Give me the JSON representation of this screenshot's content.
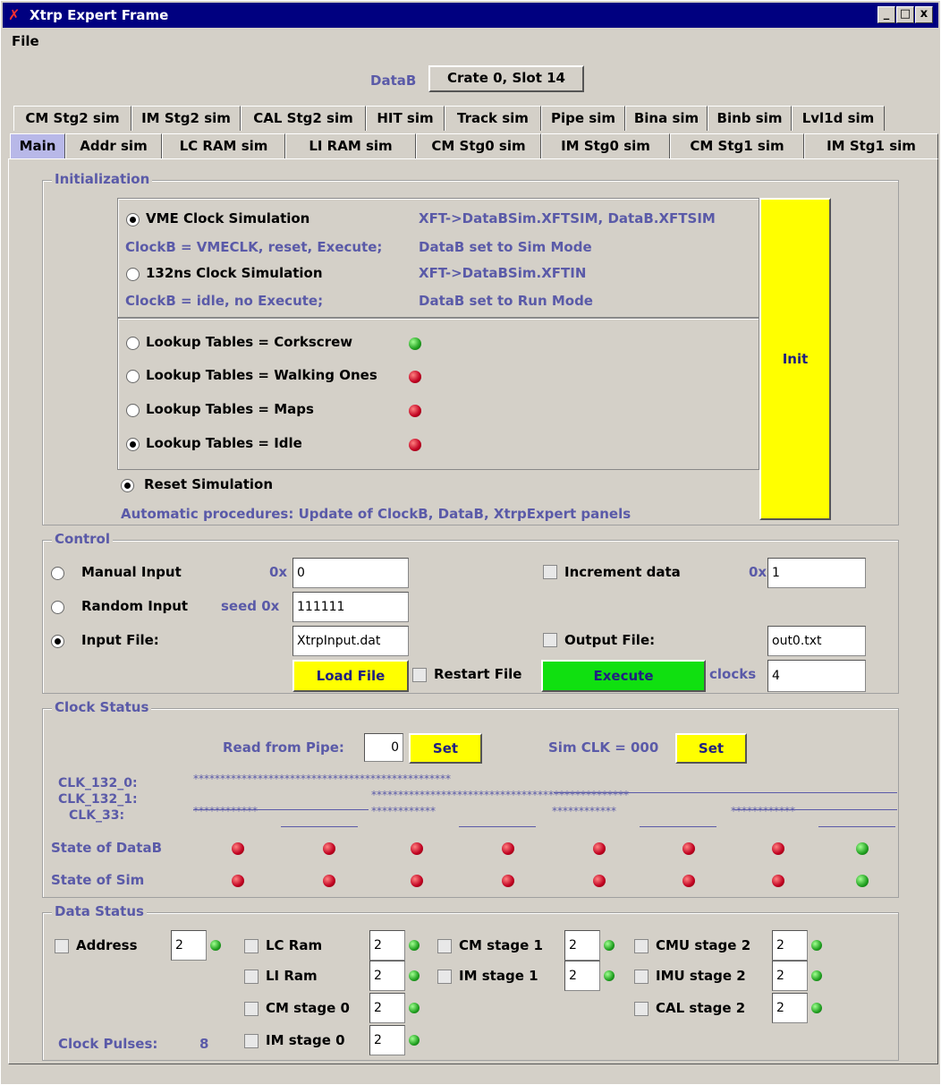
{
  "window": {
    "title": "Xtrp Expert Frame",
    "min": "_",
    "max": "□",
    "close": "x"
  },
  "menu": {
    "file": "File"
  },
  "header": {
    "datab_label": "DataB",
    "crate_button": "Crate 0, Slot 14"
  },
  "tabs_row1": [
    "CM Stg2 sim",
    "IM Stg2 sim",
    "CAL Stg2 sim",
    "HIT sim",
    "Track sim",
    "Pipe sim",
    "Bina sim",
    "Binb sim",
    "Lvl1d sim"
  ],
  "tabs_row2": [
    "Main",
    "Addr sim",
    "LC RAM sim",
    "LI RAM sim",
    "CM Stg0 sim",
    "IM Stg0 sim",
    "CM Stg1 sim",
    "IM Stg1 sim"
  ],
  "initialization": {
    "legend": "Initialization",
    "vme_clock": "VME Clock Simulation",
    "vme_desc": "XFT->DataBSim.XFTSIM, DataB.XFTSIM",
    "vme_clockb": "ClockB = VMECLK, reset, Execute;",
    "vme_datab": "DataB set to Sim Mode",
    "clk132": "132ns Clock Simulation",
    "clk132_desc": "XFT->DataBSim.XFTIN",
    "clk132_clockb": "ClockB = idle, no Execute;",
    "clk132_datab": "DataB set to Run Mode",
    "lookup": [
      "Lookup Tables = Corkscrew",
      "Lookup Tables = Walking Ones",
      "Lookup Tables = Maps",
      "Lookup Tables = Idle"
    ],
    "lookup_status": [
      "green",
      "red",
      "red",
      "red"
    ],
    "reset": "Reset Simulation",
    "auto_proc": "Automatic procedures:  Update of ClockB, DataB, XtrpExpert panels",
    "init_button": "Init"
  },
  "control": {
    "legend": "Control",
    "manual": "Manual Input",
    "manual_prefix": "0x",
    "manual_value": "0",
    "random": "Random Input",
    "seed_prefix": "seed  0x",
    "seed_value": "111111",
    "input_file": "Input File:",
    "input_file_value": "XtrpInput.dat",
    "load_file": "Load File",
    "restart_file": "Restart File",
    "increment": "Increment data",
    "increment_prefix": "0x",
    "increment_value": "1",
    "output_file": "Output File:",
    "output_file_value": "out0.txt",
    "execute": "Execute",
    "clocks_label": "clocks",
    "clocks_value": "4"
  },
  "clock_status": {
    "legend": "Clock Status",
    "read_from_pipe": "Read from Pipe:",
    "pipe_value": "0",
    "set1": "Set",
    "sim_clk": "Sim CLK = 000",
    "set2": "Set",
    "clk132_0": "CLK_132_0:",
    "clk132_1": "CLK_132_1:",
    "clk33": "CLK_33:",
    "state_datab": "State of DataB",
    "state_sim": "State of Sim",
    "datab_leds": [
      "red",
      "red",
      "red",
      "red",
      "red",
      "red",
      "red",
      "green"
    ],
    "sim_leds": [
      "red",
      "red",
      "red",
      "red",
      "red",
      "red",
      "red",
      "green"
    ]
  },
  "data_status": {
    "legend": "Data Status",
    "items": [
      {
        "label": "Address",
        "value": "2"
      },
      {
        "label": "LC Ram",
        "value": "2"
      },
      {
        "label": "LI Ram",
        "value": "2"
      },
      {
        "label": "CM stage 0",
        "value": "2"
      },
      {
        "label": "IM stage 0",
        "value": "2"
      },
      {
        "label": "CM stage 1",
        "value": "2"
      },
      {
        "label": "IM stage 1",
        "value": "2"
      },
      {
        "label": "CMU stage 2",
        "value": "2"
      },
      {
        "label": "IMU stage 2",
        "value": "2"
      },
      {
        "label": "CAL stage 2",
        "value": "2"
      }
    ],
    "clock_pulses_label": "Clock Pulses:",
    "clock_pulses_value": "8"
  }
}
